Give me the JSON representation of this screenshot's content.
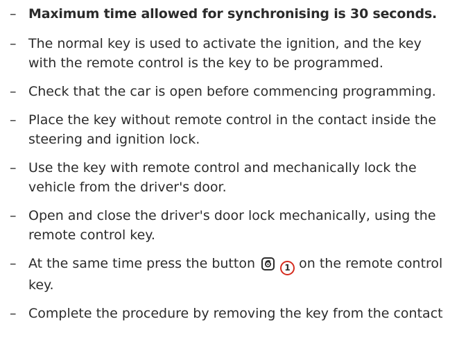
{
  "items": [
    "Maximum time allowed for synchronising is 30 seconds.",
    "The normal key is used to activate the ignition, and the key with the remote control is the key to be programmed.",
    "Check that the car is open before commencing programming.",
    "Place the key without remote control in the contact inside the steering and ignition lock.",
    "Use the key with remote control and mechanically lock the vehicle from the driver's door.",
    "Open and close the driver's door lock mechanically, using the remote control key.",
    {
      "before": "At the same time press the button",
      "callout": "1",
      "after": "on the remote control key."
    },
    "Complete the procedure by removing the key from the contact"
  ],
  "dash": "–",
  "icons": {
    "button_icon": "unlock-key-icon",
    "callout_color": "#d52b1e"
  }
}
